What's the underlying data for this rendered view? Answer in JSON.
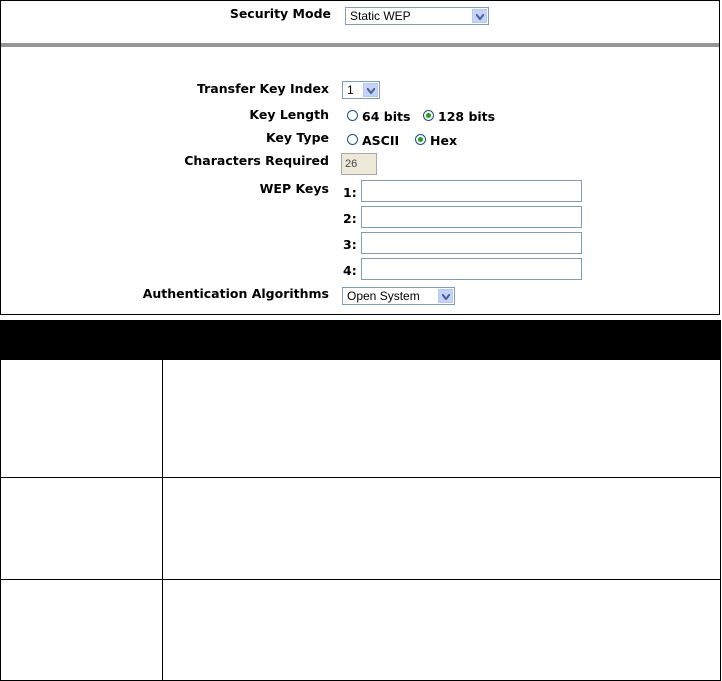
{
  "security_mode": {
    "label": "Security Mode",
    "value": "Static WEP"
  },
  "transfer_key_index": {
    "label": "Transfer Key Index",
    "value": "1"
  },
  "key_length": {
    "label": "Key Length",
    "options": [
      "64 bits",
      "128 bits"
    ],
    "selected": "128 bits"
  },
  "key_type": {
    "label": "Key Type",
    "options": [
      "ASCII",
      "Hex"
    ],
    "selected": "Hex"
  },
  "characters_required": {
    "label": "Characters Required",
    "value": "26"
  },
  "wep_keys": {
    "label": "WEP Keys",
    "keys": [
      {
        "index": "1:",
        "value": ""
      },
      {
        "index": "2:",
        "value": ""
      },
      {
        "index": "3:",
        "value": ""
      },
      {
        "index": "4:",
        "value": ""
      }
    ]
  },
  "authentication": {
    "label": "Authentication Algorithms",
    "value": "Open System"
  },
  "colors": {
    "accent_radio": "#21a121",
    "divider": "#969696",
    "table_header": "#000000"
  },
  "icons": {
    "dropdown": "chevron-down-icon",
    "radio": "radio-button-icon"
  }
}
